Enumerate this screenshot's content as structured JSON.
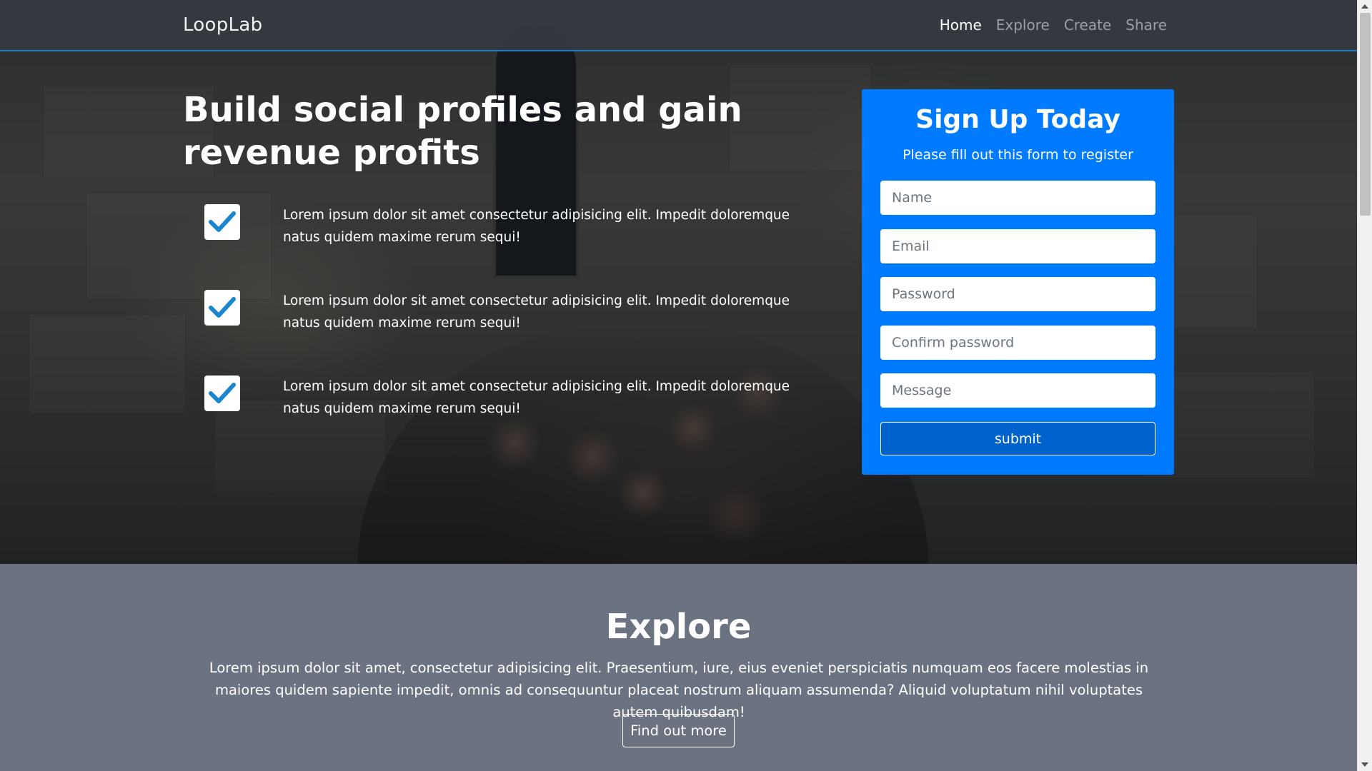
{
  "navbar": {
    "brand": "LoopLab",
    "links": [
      {
        "label": "Home",
        "active": true
      },
      {
        "label": "Explore",
        "active": false
      },
      {
        "label": "Create",
        "active": false
      },
      {
        "label": "Share",
        "active": false
      }
    ]
  },
  "hero": {
    "title": "Build social profiles and gain revenue profits",
    "features": [
      {
        "icon": "checkmark-icon",
        "text": "Lorem ipsum dolor sit amet consectetur adipisicing elit. Impedit doloremque natus quidem maxime rerum sequi!"
      },
      {
        "icon": "checkmark-icon",
        "text": "Lorem ipsum dolor sit amet consectetur adipisicing elit. Impedit doloremque natus quidem maxime rerum sequi!"
      },
      {
        "icon": "checkmark-icon",
        "text": "Lorem ipsum dolor sit amet consectetur adipisicing elit. Impedit doloremque natus quidem maxime rerum sequi!"
      }
    ]
  },
  "signup": {
    "title": "Sign Up Today",
    "subtitle": "Please fill out this form to register",
    "fields": {
      "name": {
        "placeholder": "Name",
        "value": ""
      },
      "email": {
        "placeholder": "Email",
        "value": ""
      },
      "password": {
        "placeholder": "Password",
        "value": ""
      },
      "confirm_password": {
        "placeholder": "Confirm password",
        "value": ""
      },
      "message": {
        "placeholder": "Message",
        "value": ""
      }
    },
    "submit_label": "submit"
  },
  "explore": {
    "title": "Explore",
    "text": "Lorem ipsum dolor sit amet, consectetur adipisicing elit. Praesentium, iure, eius eveniet perspiciatis numquam eos facere molestias in maiores quidem sapiente impedit, omnis ad consequuntur placeat nostrum aliquam assumenda? Aliquid voluptatum nihil voluptates autem quibusdam!",
    "button_label": "Find out more"
  },
  "colors": {
    "primary": "#007bff",
    "navbar": "#343a40",
    "navbar_border": "#1d7fc9",
    "explore_bg": "#6b7280",
    "check": "#1a86d0"
  }
}
